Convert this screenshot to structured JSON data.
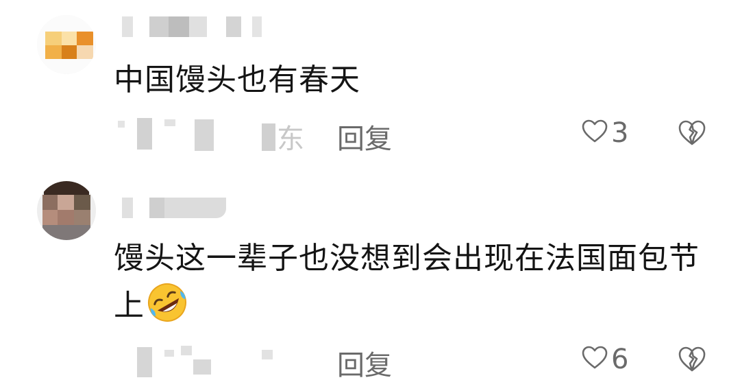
{
  "comments": [
    {
      "text": "中国馒头也有春天",
      "meta_fragment": "东",
      "reply_label": "回复",
      "like_count": "3",
      "icons": {
        "like": "heart-outline-icon",
        "dislike": "broken-heart-icon"
      }
    },
    {
      "text": "馒头这一辈子也没想到会出现在法国面包节上",
      "emoji": "rolling-on-floor-laughing-emoji",
      "reply_label": "回复",
      "like_count": "6",
      "icons": {
        "like": "heart-outline-icon",
        "dislike": "broken-heart-icon"
      }
    }
  ],
  "colors": {
    "text": "#141414",
    "meta": "#6a6a6a",
    "blur": "#d8d8d8"
  }
}
